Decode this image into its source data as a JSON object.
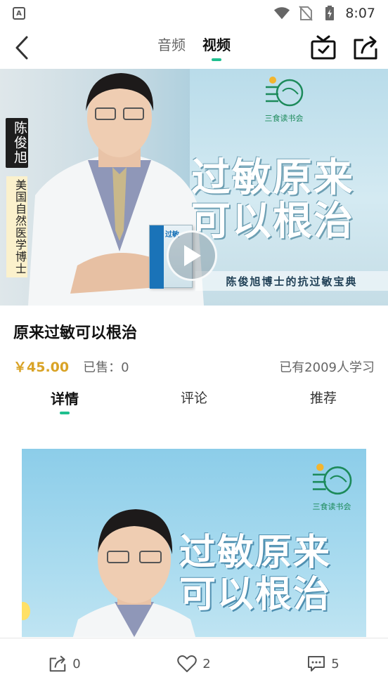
{
  "status_bar": {
    "time": "8:07",
    "icons": [
      "app-a-icon",
      "wifi-icon",
      "no-sim-icon",
      "battery-charging-icon"
    ]
  },
  "nav": {
    "tabs": [
      {
        "label": "音频",
        "active": false
      },
      {
        "label": "视频",
        "active": true
      }
    ],
    "icons": [
      "back-icon",
      "tv-icon",
      "share-icon"
    ]
  },
  "banner": {
    "doctor_name": "陈俊旭",
    "doctor_title": "美国自然医学博士",
    "logo_text": "三食读书会",
    "headline_line1": "过敏原来",
    "headline_line2": "可以根治",
    "subtitle": "陈俊旭博士的抗过敏宝典",
    "book_title": "过敏"
  },
  "product": {
    "title": "原来过敏可以根治",
    "price": "￥45.00",
    "sold": "已售：0",
    "learners": "已有2009人学习"
  },
  "detail_tabs": [
    {
      "label": "详情",
      "active": true
    },
    {
      "label": "评论",
      "active": false
    },
    {
      "label": "推荐",
      "active": false
    }
  ],
  "content_image": {
    "logo_text": "三食读书会",
    "headline_line1": "过敏原来",
    "headline_line2": "可以根治"
  },
  "bottom_bar": {
    "share_count": "0",
    "like_count": "2",
    "comment_count": "5"
  },
  "colors": {
    "accent": "#1fbf8f",
    "price": "#d9a326"
  }
}
